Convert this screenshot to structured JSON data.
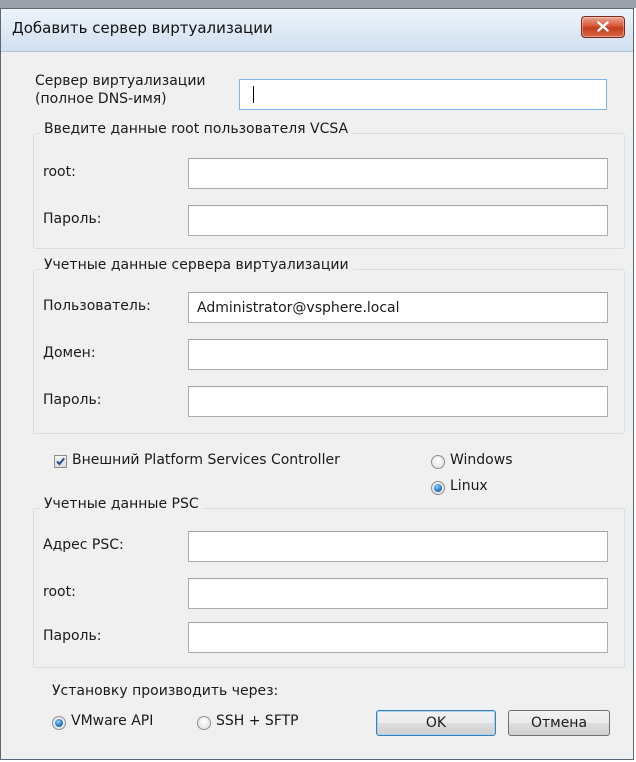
{
  "dialog": {
    "title": "Добавить сервер виртуализации",
    "server_label_line1": "Сервер виртуализации",
    "server_label_line2": "(полное DNS-имя)",
    "server_value": ""
  },
  "vcsa_group": {
    "legend": "Введите данные root пользователя VCSA",
    "root_label": "root:",
    "root_value": "",
    "password_label": "Пароль:",
    "password_value": ""
  },
  "virt_credentials": {
    "legend": "Учетные данные сервера виртуализации",
    "user_label": "Пользователь:",
    "user_value": "Administrator@vsphere.local",
    "domain_label": "Домен:",
    "domain_value": "",
    "password_label": "Пароль:",
    "password_value": ""
  },
  "external_psc": {
    "label": "Внешний Platform Services Controller",
    "checked": true,
    "os_options": [
      "Windows",
      "Linux"
    ],
    "os_selected": "Linux"
  },
  "psc_group": {
    "legend": "Учетные данные PSC",
    "address_label": "Адрес PSC:",
    "address_value": "",
    "root_label": "root:",
    "root_value": "",
    "password_label": "Пароль:",
    "password_value": ""
  },
  "install": {
    "label": "Установку производить через:",
    "options": [
      "VMware API",
      "SSH + SFTP"
    ],
    "selected": "VMware API"
  },
  "buttons": {
    "ok": "OK",
    "cancel": "Отмена"
  }
}
